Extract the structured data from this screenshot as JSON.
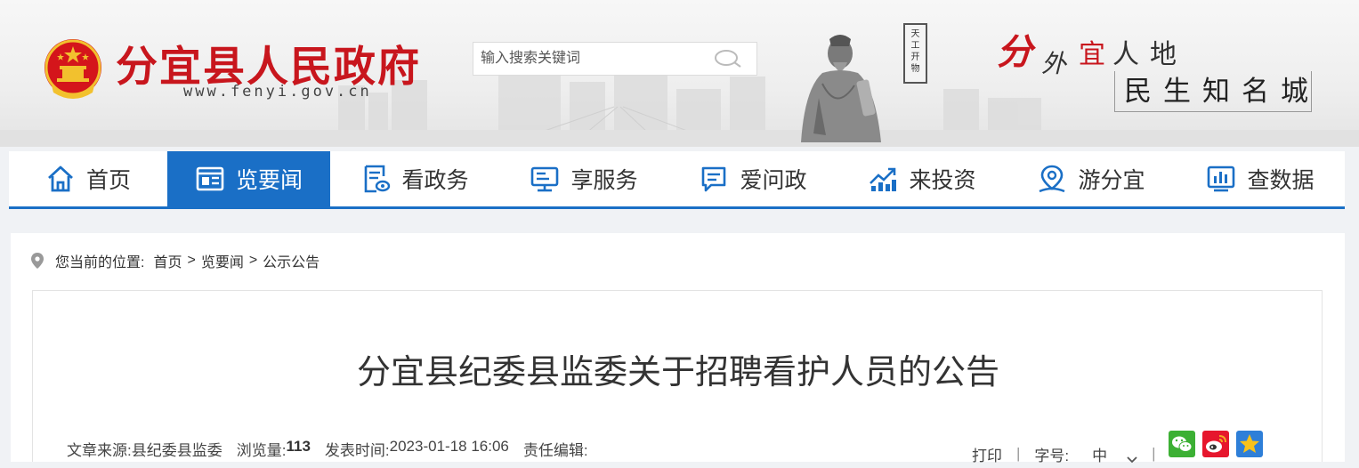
{
  "header": {
    "site_title": "分宜县人民政府",
    "site_url": "www.fenyi.gov.cn",
    "search_placeholder": "输入搜索关键词",
    "seal_text": [
      "天",
      "工",
      "开",
      "物"
    ],
    "slogan_top": [
      "分",
      "外",
      "宜",
      "人",
      "地"
    ],
    "slogan_bottom": "民生知名城"
  },
  "nav": {
    "items": [
      {
        "label": "首页",
        "icon": "home-icon",
        "active": false
      },
      {
        "label": "览要闻",
        "icon": "news-icon",
        "active": true
      },
      {
        "label": "看政务",
        "icon": "document-icon",
        "active": false
      },
      {
        "label": "享服务",
        "icon": "monitor-icon",
        "active": false
      },
      {
        "label": "爱问政",
        "icon": "chat-icon",
        "active": false
      },
      {
        "label": "来投资",
        "icon": "chart-trend-icon",
        "active": false
      },
      {
        "label": "游分宜",
        "icon": "location-icon",
        "active": false
      },
      {
        "label": "查数据",
        "icon": "bar-chart-icon",
        "active": false
      }
    ]
  },
  "breadcrumb": {
    "prefix": "您当前的位置:",
    "items": [
      "首页",
      "览要闻",
      "公示公告"
    ],
    "separator": ">"
  },
  "article": {
    "title": "分宜县纪委县监委关于招聘看护人员的公告",
    "source_label": "文章来源:",
    "source_value": "县纪委县监委",
    "views_label": "浏览量:",
    "views_value": "113",
    "time_label": "发表时间:",
    "time_value": "2023-01-18 16:06",
    "editor_label": "责任编辑:",
    "editor_value": ""
  },
  "tools": {
    "print_label": "打印",
    "separator": "|",
    "font_label": "字号:",
    "font_value": "中",
    "share": [
      "wechat-icon",
      "weibo-icon",
      "qzone-icon"
    ]
  },
  "colors": {
    "brand_red": "#c8161d",
    "nav_blue": "#1a6fc6",
    "page_bg": "#f0f2f5"
  }
}
